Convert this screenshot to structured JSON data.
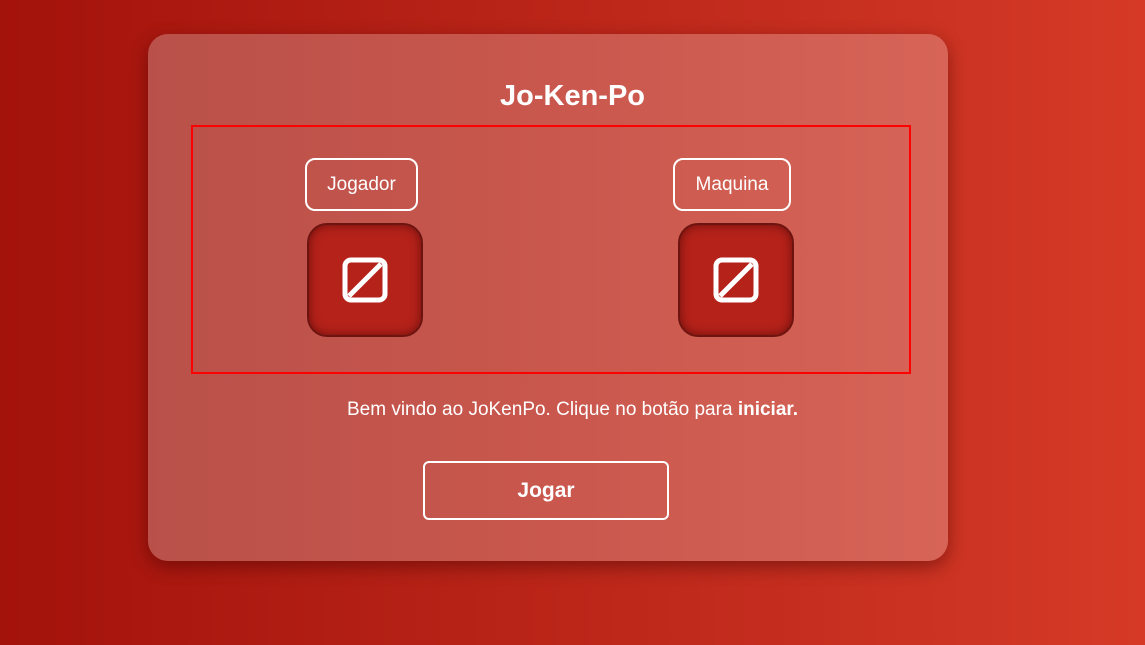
{
  "game": {
    "title": "Jo-Ken-Po"
  },
  "player": {
    "label": "Jogador",
    "choice_icon": "no-image-icon"
  },
  "machine": {
    "label": "Maquina",
    "choice_icon": "no-image-icon"
  },
  "message": {
    "text": "Bem vindo ao JoKenPo. Clique no botão para ",
    "emphasis": "iniciar."
  },
  "controls": {
    "play_label": "Jogar"
  },
  "colors": {
    "background": "#b81f15",
    "card": "#c9574d",
    "arena_border": "#ff0000",
    "tile": "#b5221a",
    "text": "#ffffff"
  }
}
